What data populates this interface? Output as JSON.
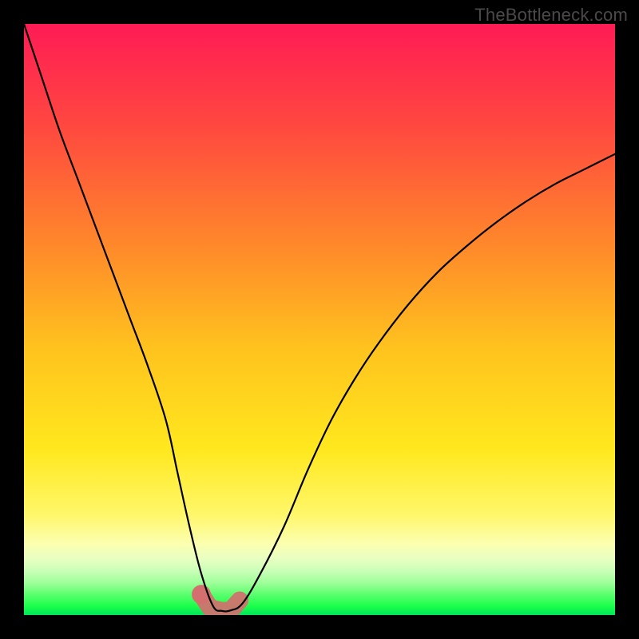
{
  "watermark": "TheBottleneck.com",
  "chart_data": {
    "type": "line",
    "title": "",
    "xlabel": "",
    "ylabel": "",
    "xlim": [
      0,
      100
    ],
    "ylim": [
      0,
      100
    ],
    "grid": false,
    "legend": false,
    "background": {
      "type": "vertical-gradient",
      "stops": [
        {
          "pos": 0.0,
          "color": "#ff1b55"
        },
        {
          "pos": 0.18,
          "color": "#ff4a3f"
        },
        {
          "pos": 0.38,
          "color": "#ff8a2a"
        },
        {
          "pos": 0.55,
          "color": "#ffc31e"
        },
        {
          "pos": 0.72,
          "color": "#ffe81e"
        },
        {
          "pos": 0.83,
          "color": "#fff76a"
        },
        {
          "pos": 0.88,
          "color": "#fbffb0"
        },
        {
          "pos": 0.905,
          "color": "#e8ffc2"
        },
        {
          "pos": 0.925,
          "color": "#c9ffb8"
        },
        {
          "pos": 0.945,
          "color": "#a0ff9a"
        },
        {
          "pos": 0.965,
          "color": "#5cff6e"
        },
        {
          "pos": 0.985,
          "color": "#1bff4a"
        },
        {
          "pos": 1.0,
          "color": "#00e65a"
        }
      ]
    },
    "series": [
      {
        "name": "bottleneck-curve",
        "x": [
          0,
          3,
          6,
          9,
          12,
          15,
          18,
          21,
          24,
          26,
          28,
          30,
          32,
          33.5,
          35,
          37,
          40,
          44,
          48,
          52,
          56,
          60,
          65,
          70,
          75,
          80,
          85,
          90,
          95,
          100
        ],
        "y": [
          100,
          91,
          82,
          74,
          66,
          58,
          50,
          42,
          33,
          24,
          15,
          7,
          1.5,
          0.7,
          0.8,
          2,
          7,
          15,
          24.5,
          33,
          40,
          46,
          52.5,
          58,
          62.5,
          66.5,
          70,
          73,
          75.5,
          78
        ]
      }
    ],
    "highlight": {
      "name": "optimal-region",
      "x": [
        30,
        31.5,
        33.5,
        35,
        36.5
      ],
      "y": [
        3.5,
        1.2,
        0.7,
        0.8,
        2.5
      ],
      "color": "#d46f6f"
    }
  }
}
